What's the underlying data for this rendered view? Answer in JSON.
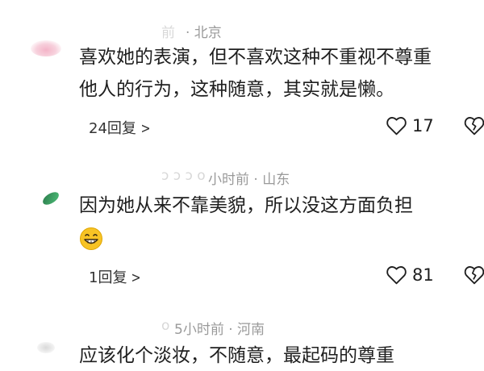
{
  "comments": [
    {
      "author_faded": "前",
      "meta": "· 北京",
      "text_line1": "喜欢她的表演，但不喜欢这种不重视不尊重",
      "text_line2": "他人的行为，这种随意，其实就是懒。",
      "replies": "24回复",
      "likes": "17"
    },
    {
      "author_faded": "o",
      "meta": "小时前 · 山东",
      "text_line1": "因为她从来不靠美貌，所以没这方面负担",
      "replies": "1回复",
      "likes": "81"
    },
    {
      "author_faded": "o",
      "meta": "5小时前 · 河南",
      "text_line1": "应该化个淡妆，不随意，最起码的尊重"
    }
  ],
  "colors": {
    "meta_gray": "#9a9a9a",
    "text_dark": "#1f1f1f",
    "emoji_yellow": "#f7c325"
  },
  "icons": {
    "like": "heart-outline-icon",
    "dislike": "broken-heart-icon",
    "replies": "chevron-right-icon",
    "emoji": "grinning-face-emoji"
  }
}
